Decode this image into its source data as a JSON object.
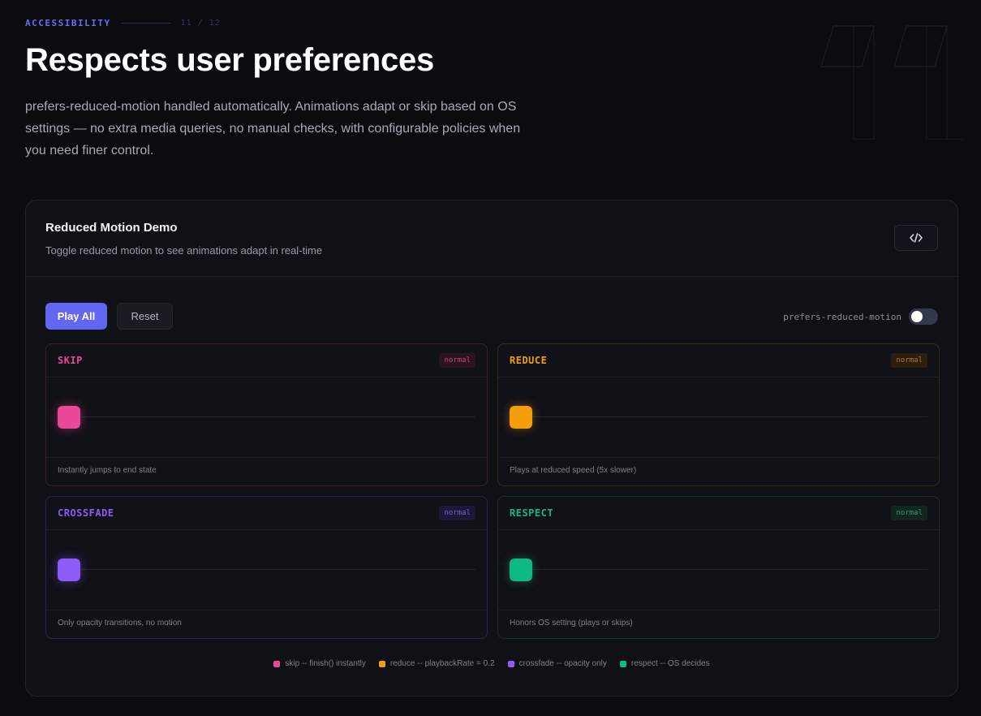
{
  "header": {
    "eyebrow": "ACCESSIBILITY",
    "counter": "11 / 12",
    "title": "Respects user preferences",
    "description": "prefers-reduced-motion handled automatically. Animations adapt or skip based on OS settings — no extra media queries, no manual checks, with configurable policies when you need finer control."
  },
  "demo": {
    "title": "Reduced Motion Demo",
    "subtitle": "Toggle reduced motion to see animations adapt in real-time",
    "code_button_icon": "code-icon",
    "play_all_label": "Play All",
    "reset_label": "Reset",
    "toggle_label": "prefers-reduced-motion",
    "toggle_on": false
  },
  "panels": [
    {
      "name": "SKIP",
      "badge": "normal",
      "description": "Instantly jumps to end state",
      "color": "#ec4899",
      "progress": 0
    },
    {
      "name": "REDUCE",
      "badge": "normal",
      "description": "Plays at reduced speed (5x slower)",
      "color": "#f59e0b",
      "progress": 0
    },
    {
      "name": "CROSSFADE",
      "badge": "normal",
      "description": "Only opacity transitions, no motion",
      "color": "#8b5cf6",
      "progress": 0
    },
    {
      "name": "RESPECT",
      "badge": "normal",
      "description": "Honors OS setting (plays or skips)",
      "color": "#10b981",
      "progress": 0
    }
  ],
  "legend": [
    {
      "label": "skip -- finish() instantly",
      "color": "#ec4899"
    },
    {
      "label": "reduce -- playbackRate = 0.2",
      "color": "#f59e0b"
    },
    {
      "label": "crossfade -- opacity only",
      "color": "#8b5cf6"
    },
    {
      "label": "respect -- OS decides",
      "color": "#10b981"
    }
  ],
  "colors": {
    "accent": "#6366f1",
    "skip": "#ec4899",
    "reduce": "#f59e0b",
    "crossfade": "#8b5cf6",
    "respect": "#10b981"
  }
}
